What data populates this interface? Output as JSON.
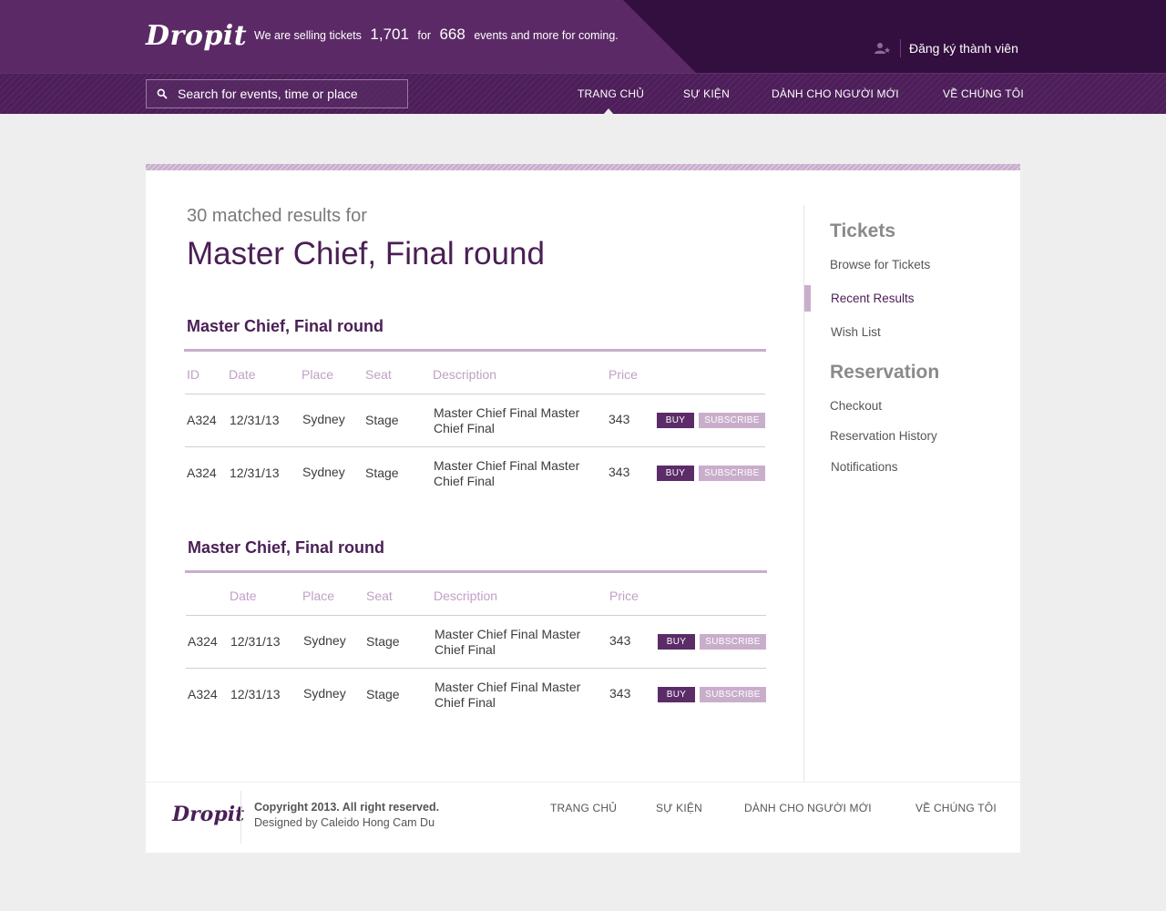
{
  "header": {
    "logo": "Dropit",
    "tagline_prefix": "We are selling tickets",
    "tickets_count": "1,701",
    "tagline_for": "for",
    "events_count": "668",
    "tagline_suffix": "events and more for coming.",
    "register_label": "Đăng ký thành viên"
  },
  "search": {
    "placeholder": "Search for events, time or place"
  },
  "nav": {
    "items": [
      "TRANG CHỦ",
      "SỰ KIỆN",
      "DÀNH CHO NGƯỜI MỚI",
      "VỀ CHÚNG TÔI"
    ],
    "active": "TRANG CHỦ"
  },
  "results": {
    "count_text": "30 matched results for",
    "query": "Master Chief, Final round"
  },
  "groups": [
    {
      "title": "Master Chief, Final round",
      "headers": [
        "ID",
        "Date",
        "Place",
        "Seat",
        "Description",
        "Price"
      ],
      "rows": [
        {
          "id": "A324",
          "date": "12/31/13",
          "place": "Sydney",
          "seat": "Stage",
          "description": "Master Chief Final Master Chief Final",
          "price": "343"
        },
        {
          "id": "A324",
          "date": "12/31/13",
          "place": "Sydney",
          "seat": "Stage",
          "description": "Master Chief Final Master Chief Final",
          "price": "343"
        }
      ]
    },
    {
      "title": "Master Chief, Final round",
      "headers": [
        "",
        "Date",
        "Place",
        "Seat",
        "Description",
        "Price"
      ],
      "rows": [
        {
          "id": "A324",
          "date": "12/31/13",
          "place": "Sydney",
          "seat": "Stage",
          "description": "Master Chief Final Master Chief Final",
          "price": "343"
        },
        {
          "id": "A324",
          "date": "12/31/13",
          "place": "Sydney",
          "seat": "Stage",
          "description": "Master Chief Final Master Chief Final",
          "price": "343"
        }
      ]
    }
  ],
  "buttons": {
    "buy": "BUY",
    "subscribe": "SUBSCRIBE"
  },
  "sidebar": {
    "tickets_heading": "Tickets",
    "tickets_links": [
      "Browse for Tickets",
      "Recent Results",
      "Wish List"
    ],
    "active_link": "Recent Results",
    "reservation_heading": "Reservation",
    "reservation_links": [
      "Checkout",
      "Reservation History",
      "Notifications"
    ]
  },
  "footer": {
    "logo": "Dropit",
    "copyright": "Copyright 2013. All right reserved.",
    "designed_by": "Designed by Caleido Hong Cam Du",
    "nav": [
      "TRANG CHỦ",
      "SỰ KIỆN",
      "DÀNH CHO NGƯỜI MỚI",
      "VỀ CHÚNG TÔI"
    ]
  },
  "colors": {
    "brand_purple": "#4a1f55",
    "header_dark": "#330f3f",
    "header_light": "#5b2a66",
    "accent_lilac": "#c9aecb",
    "buy_button": "#5b2c68"
  },
  "icons": {
    "search": "search-icon",
    "register": "user-add-icon"
  }
}
